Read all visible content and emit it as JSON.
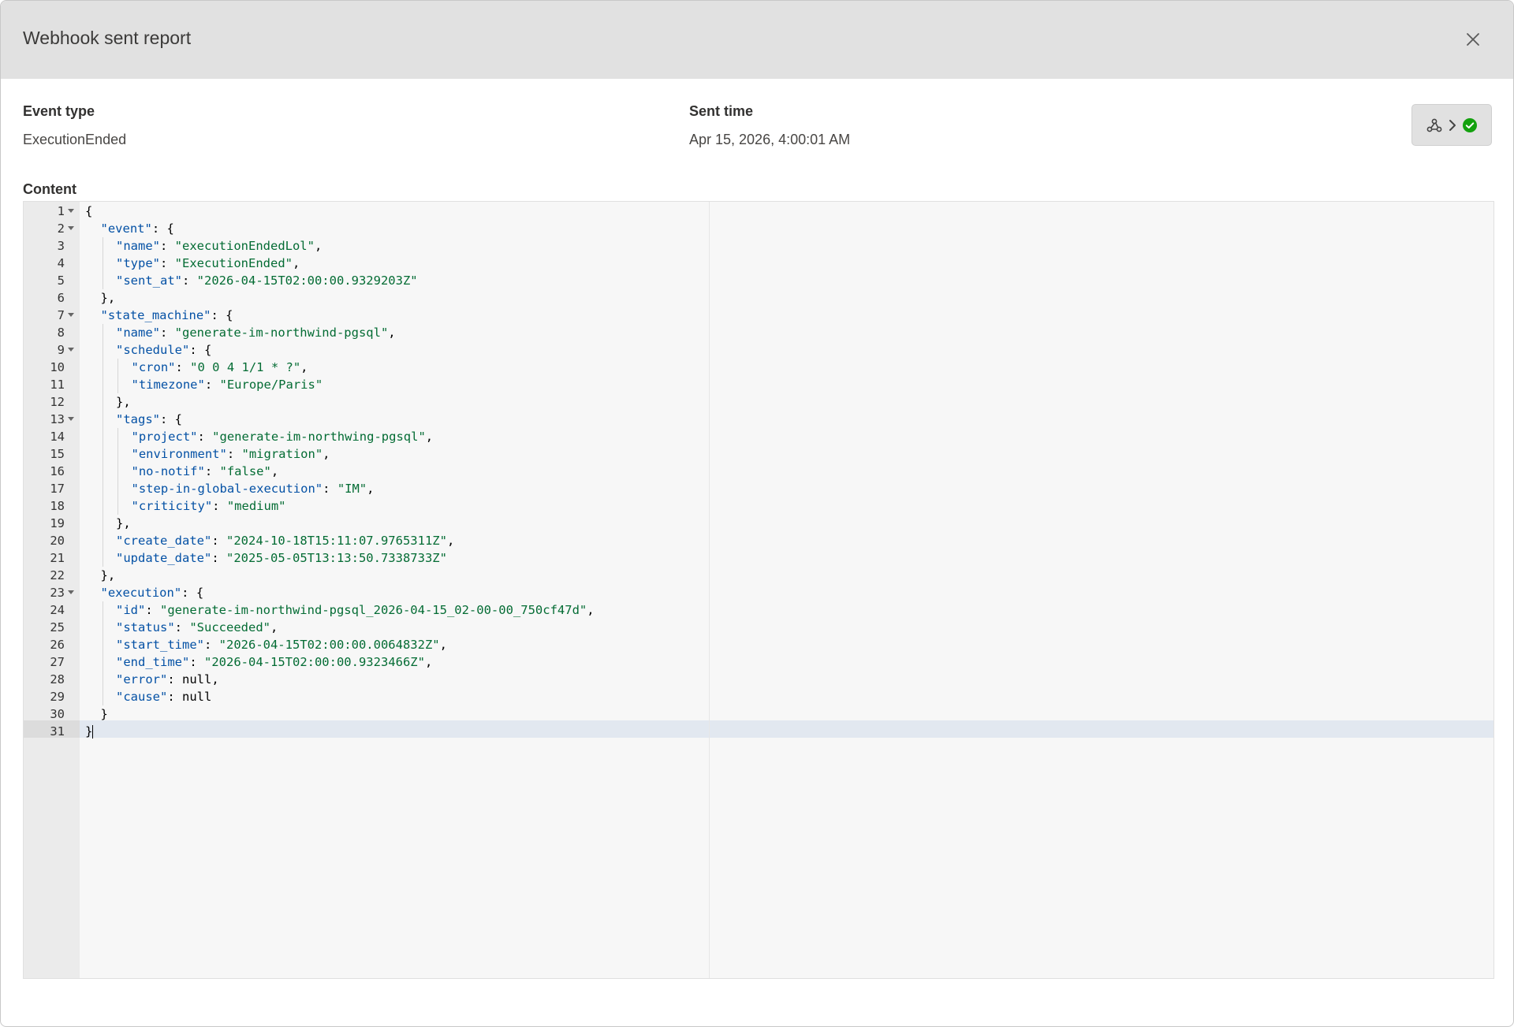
{
  "dialog": {
    "title": "Webhook sent report",
    "close_icon": "close-icon"
  },
  "fields": {
    "event_type_label": "Event type",
    "event_type_value": "ExecutionEnded",
    "sent_time_label": "Sent time",
    "sent_time_value": "Apr 15, 2026, 4:00:01 AM",
    "content_label": "Content"
  },
  "status_chip": {
    "icons": [
      "webhook-icon",
      "chevron-right-icon",
      "success-check-icon"
    ],
    "success_color": "#13a10e"
  },
  "editor": {
    "active_line": 31,
    "lines": [
      {
        "n": "1",
        "indent": 0,
        "fold": true,
        "tokens": [
          {
            "c": "p",
            "t": "{"
          }
        ]
      },
      {
        "n": "2",
        "indent": 1,
        "fold": true,
        "tokens": [
          {
            "c": "k",
            "t": "\"event\""
          },
          {
            "c": "p",
            "t": ": {"
          }
        ]
      },
      {
        "n": "3",
        "indent": 2,
        "fold": false,
        "tokens": [
          {
            "c": "k",
            "t": "\"name\""
          },
          {
            "c": "p",
            "t": ": "
          },
          {
            "c": "s",
            "t": "\"executionEndedLol\""
          },
          {
            "c": "p",
            "t": ","
          }
        ]
      },
      {
        "n": "4",
        "indent": 2,
        "fold": false,
        "tokens": [
          {
            "c": "k",
            "t": "\"type\""
          },
          {
            "c": "p",
            "t": ": "
          },
          {
            "c": "s",
            "t": "\"ExecutionEnded\""
          },
          {
            "c": "p",
            "t": ","
          }
        ]
      },
      {
        "n": "5",
        "indent": 2,
        "fold": false,
        "tokens": [
          {
            "c": "k",
            "t": "\"sent_at\""
          },
          {
            "c": "p",
            "t": ": "
          },
          {
            "c": "s",
            "t": "\"2026-04-15T02:00:00.9329203Z\""
          }
        ]
      },
      {
        "n": "6",
        "indent": 1,
        "fold": false,
        "tokens": [
          {
            "c": "p",
            "t": "},"
          }
        ]
      },
      {
        "n": "7",
        "indent": 1,
        "fold": true,
        "tokens": [
          {
            "c": "k",
            "t": "\"state_machine\""
          },
          {
            "c": "p",
            "t": ": {"
          }
        ]
      },
      {
        "n": "8",
        "indent": 2,
        "fold": false,
        "tokens": [
          {
            "c": "k",
            "t": "\"name\""
          },
          {
            "c": "p",
            "t": ": "
          },
          {
            "c": "s",
            "t": "\"generate-im-northwind-pgsql\""
          },
          {
            "c": "p",
            "t": ","
          }
        ]
      },
      {
        "n": "9",
        "indent": 2,
        "fold": true,
        "tokens": [
          {
            "c": "k",
            "t": "\"schedule\""
          },
          {
            "c": "p",
            "t": ": {"
          }
        ]
      },
      {
        "n": "10",
        "indent": 3,
        "fold": false,
        "tokens": [
          {
            "c": "k",
            "t": "\"cron\""
          },
          {
            "c": "p",
            "t": ": "
          },
          {
            "c": "s",
            "t": "\"0 0 4 1/1 * ?\""
          },
          {
            "c": "p",
            "t": ","
          }
        ]
      },
      {
        "n": "11",
        "indent": 3,
        "fold": false,
        "tokens": [
          {
            "c": "k",
            "t": "\"timezone\""
          },
          {
            "c": "p",
            "t": ": "
          },
          {
            "c": "s",
            "t": "\"Europe/Paris\""
          }
        ]
      },
      {
        "n": "12",
        "indent": 2,
        "fold": false,
        "tokens": [
          {
            "c": "p",
            "t": "},"
          }
        ]
      },
      {
        "n": "13",
        "indent": 2,
        "fold": true,
        "tokens": [
          {
            "c": "k",
            "t": "\"tags\""
          },
          {
            "c": "p",
            "t": ": {"
          }
        ]
      },
      {
        "n": "14",
        "indent": 3,
        "fold": false,
        "tokens": [
          {
            "c": "k",
            "t": "\"project\""
          },
          {
            "c": "p",
            "t": ": "
          },
          {
            "c": "s",
            "t": "\"generate-im-northwing-pgsql\""
          },
          {
            "c": "p",
            "t": ","
          }
        ]
      },
      {
        "n": "15",
        "indent": 3,
        "fold": false,
        "tokens": [
          {
            "c": "k",
            "t": "\"environment\""
          },
          {
            "c": "p",
            "t": ": "
          },
          {
            "c": "s",
            "t": "\"migration\""
          },
          {
            "c": "p",
            "t": ","
          }
        ]
      },
      {
        "n": "16",
        "indent": 3,
        "fold": false,
        "tokens": [
          {
            "c": "k",
            "t": "\"no-notif\""
          },
          {
            "c": "p",
            "t": ": "
          },
          {
            "c": "s",
            "t": "\"false\""
          },
          {
            "c": "p",
            "t": ","
          }
        ]
      },
      {
        "n": "17",
        "indent": 3,
        "fold": false,
        "tokens": [
          {
            "c": "k",
            "t": "\"step-in-global-execution\""
          },
          {
            "c": "p",
            "t": ": "
          },
          {
            "c": "s",
            "t": "\"IM\""
          },
          {
            "c": "p",
            "t": ","
          }
        ]
      },
      {
        "n": "18",
        "indent": 3,
        "fold": false,
        "tokens": [
          {
            "c": "k",
            "t": "\"criticity\""
          },
          {
            "c": "p",
            "t": ": "
          },
          {
            "c": "s",
            "t": "\"medium\""
          }
        ]
      },
      {
        "n": "19",
        "indent": 2,
        "fold": false,
        "tokens": [
          {
            "c": "p",
            "t": "},"
          }
        ]
      },
      {
        "n": "20",
        "indent": 2,
        "fold": false,
        "tokens": [
          {
            "c": "k",
            "t": "\"create_date\""
          },
          {
            "c": "p",
            "t": ": "
          },
          {
            "c": "s",
            "t": "\"2024-10-18T15:11:07.9765311Z\""
          },
          {
            "c": "p",
            "t": ","
          }
        ]
      },
      {
        "n": "21",
        "indent": 2,
        "fold": false,
        "tokens": [
          {
            "c": "k",
            "t": "\"update_date\""
          },
          {
            "c": "p",
            "t": ": "
          },
          {
            "c": "s",
            "t": "\"2025-05-05T13:13:50.7338733Z\""
          }
        ]
      },
      {
        "n": "22",
        "indent": 1,
        "fold": false,
        "tokens": [
          {
            "c": "p",
            "t": "},"
          }
        ]
      },
      {
        "n": "23",
        "indent": 1,
        "fold": true,
        "tokens": [
          {
            "c": "k",
            "t": "\"execution\""
          },
          {
            "c": "p",
            "t": ": {"
          }
        ]
      },
      {
        "n": "24",
        "indent": 2,
        "fold": false,
        "tokens": [
          {
            "c": "k",
            "t": "\"id\""
          },
          {
            "c": "p",
            "t": ": "
          },
          {
            "c": "s",
            "t": "\"generate-im-northwind-pgsql_2026-04-15_02-00-00_750cf47d\""
          },
          {
            "c": "p",
            "t": ","
          }
        ]
      },
      {
        "n": "25",
        "indent": 2,
        "fold": false,
        "tokens": [
          {
            "c": "k",
            "t": "\"status\""
          },
          {
            "c": "p",
            "t": ": "
          },
          {
            "c": "s",
            "t": "\"Succeeded\""
          },
          {
            "c": "p",
            "t": ","
          }
        ]
      },
      {
        "n": "26",
        "indent": 2,
        "fold": false,
        "tokens": [
          {
            "c": "k",
            "t": "\"start_time\""
          },
          {
            "c": "p",
            "t": ": "
          },
          {
            "c": "s",
            "t": "\"2026-04-15T02:00:00.0064832Z\""
          },
          {
            "c": "p",
            "t": ","
          }
        ]
      },
      {
        "n": "27",
        "indent": 2,
        "fold": false,
        "tokens": [
          {
            "c": "k",
            "t": "\"end_time\""
          },
          {
            "c": "p",
            "t": ": "
          },
          {
            "c": "s",
            "t": "\"2026-04-15T02:00:00.9323466Z\""
          },
          {
            "c": "p",
            "t": ","
          }
        ]
      },
      {
        "n": "28",
        "indent": 2,
        "fold": false,
        "tokens": [
          {
            "c": "k",
            "t": "\"error\""
          },
          {
            "c": "p",
            "t": ": "
          },
          {
            "c": "n",
            "t": "null"
          },
          {
            "c": "p",
            "t": ","
          }
        ]
      },
      {
        "n": "29",
        "indent": 2,
        "fold": false,
        "tokens": [
          {
            "c": "k",
            "t": "\"cause\""
          },
          {
            "c": "p",
            "t": ": "
          },
          {
            "c": "n",
            "t": "null"
          }
        ]
      },
      {
        "n": "30",
        "indent": 1,
        "fold": false,
        "tokens": [
          {
            "c": "p",
            "t": "}"
          }
        ]
      },
      {
        "n": "31",
        "indent": 0,
        "fold": false,
        "tokens": [
          {
            "c": "p",
            "t": "}"
          }
        ]
      }
    ]
  }
}
